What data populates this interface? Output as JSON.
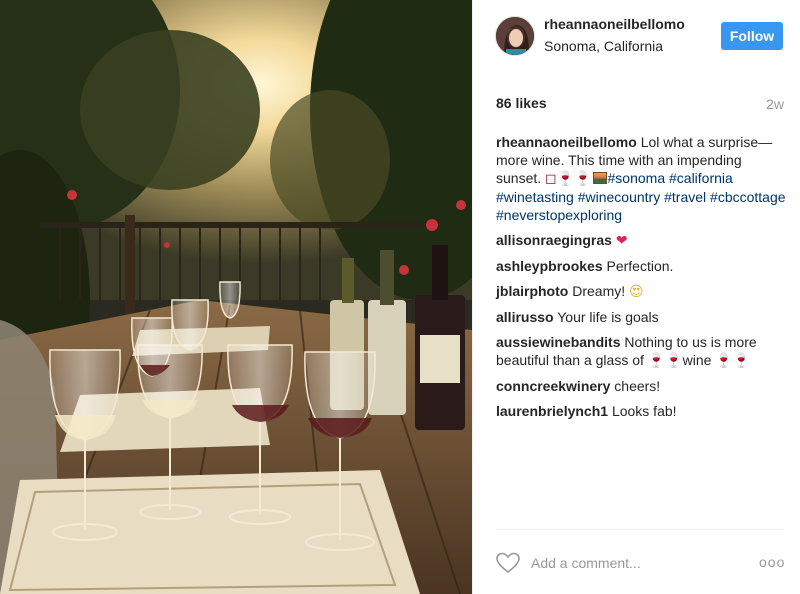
{
  "post": {
    "author": {
      "username": "rheannaoneilbellomo",
      "location": "Sonoma, California"
    },
    "follow_label": "Follow",
    "likes": "86 likes",
    "age": "2w",
    "caption": {
      "user": "rheannaoneilbellomo",
      "text": "Lol what a surprise—more wine. This time with an impending sunset. ",
      "emoji": "◻🍷🍷",
      "hashtags": [
        "#sonoma",
        "#california",
        "#winetasting",
        "#winecountry",
        "#travel",
        "#cbccottage",
        "#neverstopexploring"
      ]
    },
    "comments": [
      {
        "user": "allisonraegingras",
        "text": "",
        "emoji": "❤"
      },
      {
        "user": "ashleypbrookes",
        "text": "Perfection.",
        "emoji": ""
      },
      {
        "user": "jblairphoto",
        "text": "Dreamy!",
        "emoji": "😍"
      },
      {
        "user": "allirusso",
        "text": "Your life is goals",
        "emoji": ""
      },
      {
        "user": "aussiewinebandits",
        "text": "Nothing to us is more beautiful than a glass of",
        "emoji_mid": "🍷🍷",
        "text2": "wine",
        "emoji": "🍷🍷"
      },
      {
        "user": "conncreekwinery",
        "text": "cheers!",
        "emoji": ""
      },
      {
        "user": "laurenbrielynch1",
        "text": "Looks fab!",
        "emoji": ""
      }
    ],
    "comment_placeholder": "Add a comment...",
    "more_label": "ooo"
  },
  "colors": {
    "follow_button": "#3897f0",
    "hashtag": "#003569",
    "muted": "#999999"
  }
}
